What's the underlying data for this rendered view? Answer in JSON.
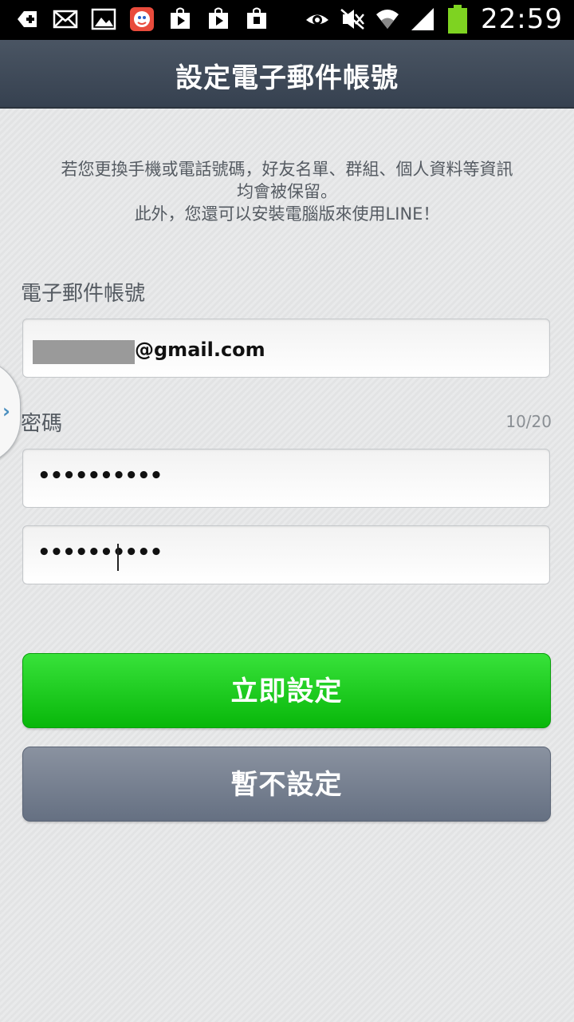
{
  "status_bar": {
    "time": "22:59",
    "left_icons": [
      "plus-message-icon",
      "mail-icon",
      "image-icon",
      "game-app-icon",
      "play-store-icon",
      "play-store-icon",
      "shopping-bag-icon"
    ],
    "right_icons": [
      "eye-icon",
      "mute-icon",
      "wifi-icon",
      "signal-icon",
      "battery-icon"
    ],
    "battery_color": "#7ed321"
  },
  "header": {
    "title": "設定電子郵件帳號"
  },
  "info": {
    "line1": "若您更換手機或電話號碼，好友名單、群組、個人資料等資訊",
    "line2": "均會被保留。",
    "line3": "此外，您還可以安裝電腦版來使用LINE！"
  },
  "email": {
    "label": "電子郵件帳號",
    "value_suffix": "@gmail.com"
  },
  "password": {
    "label": "密碼",
    "count": "10/20",
    "value_masked": "••••••••••",
    "confirm_masked": "••••••••••"
  },
  "buttons": {
    "confirm_label": "立即設定",
    "skip_label": "暫不設定"
  },
  "colors": {
    "primary_button": "#1fcf22",
    "secondary_button": "#717b8b",
    "header_bg": "#3f4a58"
  }
}
